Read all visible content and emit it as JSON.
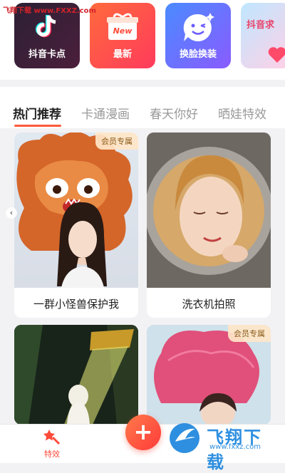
{
  "watermark_top": "飞翔下载 www.FXXZ.com",
  "categories": [
    {
      "label": "抖音卡点",
      "icon": "tiktok-note-icon"
    },
    {
      "label": "最新",
      "icon": "gift-box-new-icon",
      "badge": "New"
    },
    {
      "label": "换脸换装",
      "icon": "wink-face-icon"
    },
    {
      "label": "抖音求",
      "icon": "heart-balloon-icon"
    }
  ],
  "tabs": [
    {
      "label": "热门推荐",
      "active": true
    },
    {
      "label": "卡通漫画",
      "active": false
    },
    {
      "label": "春天你好",
      "active": false
    },
    {
      "label": "晒娃特效",
      "active": false
    }
  ],
  "cards": [
    {
      "title": "一群小怪兽保护我",
      "badge": "会员专属"
    },
    {
      "title": "洗衣机拍照",
      "badge": ""
    },
    {
      "title": "",
      "badge": ""
    },
    {
      "title": "",
      "badge": "会员专属"
    }
  ],
  "bottom_bar": {
    "effects_label": "特效",
    "fab_label": "+"
  },
  "watermark_bottom": {
    "name": "飞翔下载",
    "url": "www.fxxz.com"
  },
  "colors": {
    "accent": "#ff5a3a",
    "badge_bg": "#ffe6c8",
    "badge_text": "#8a5a1a"
  }
}
